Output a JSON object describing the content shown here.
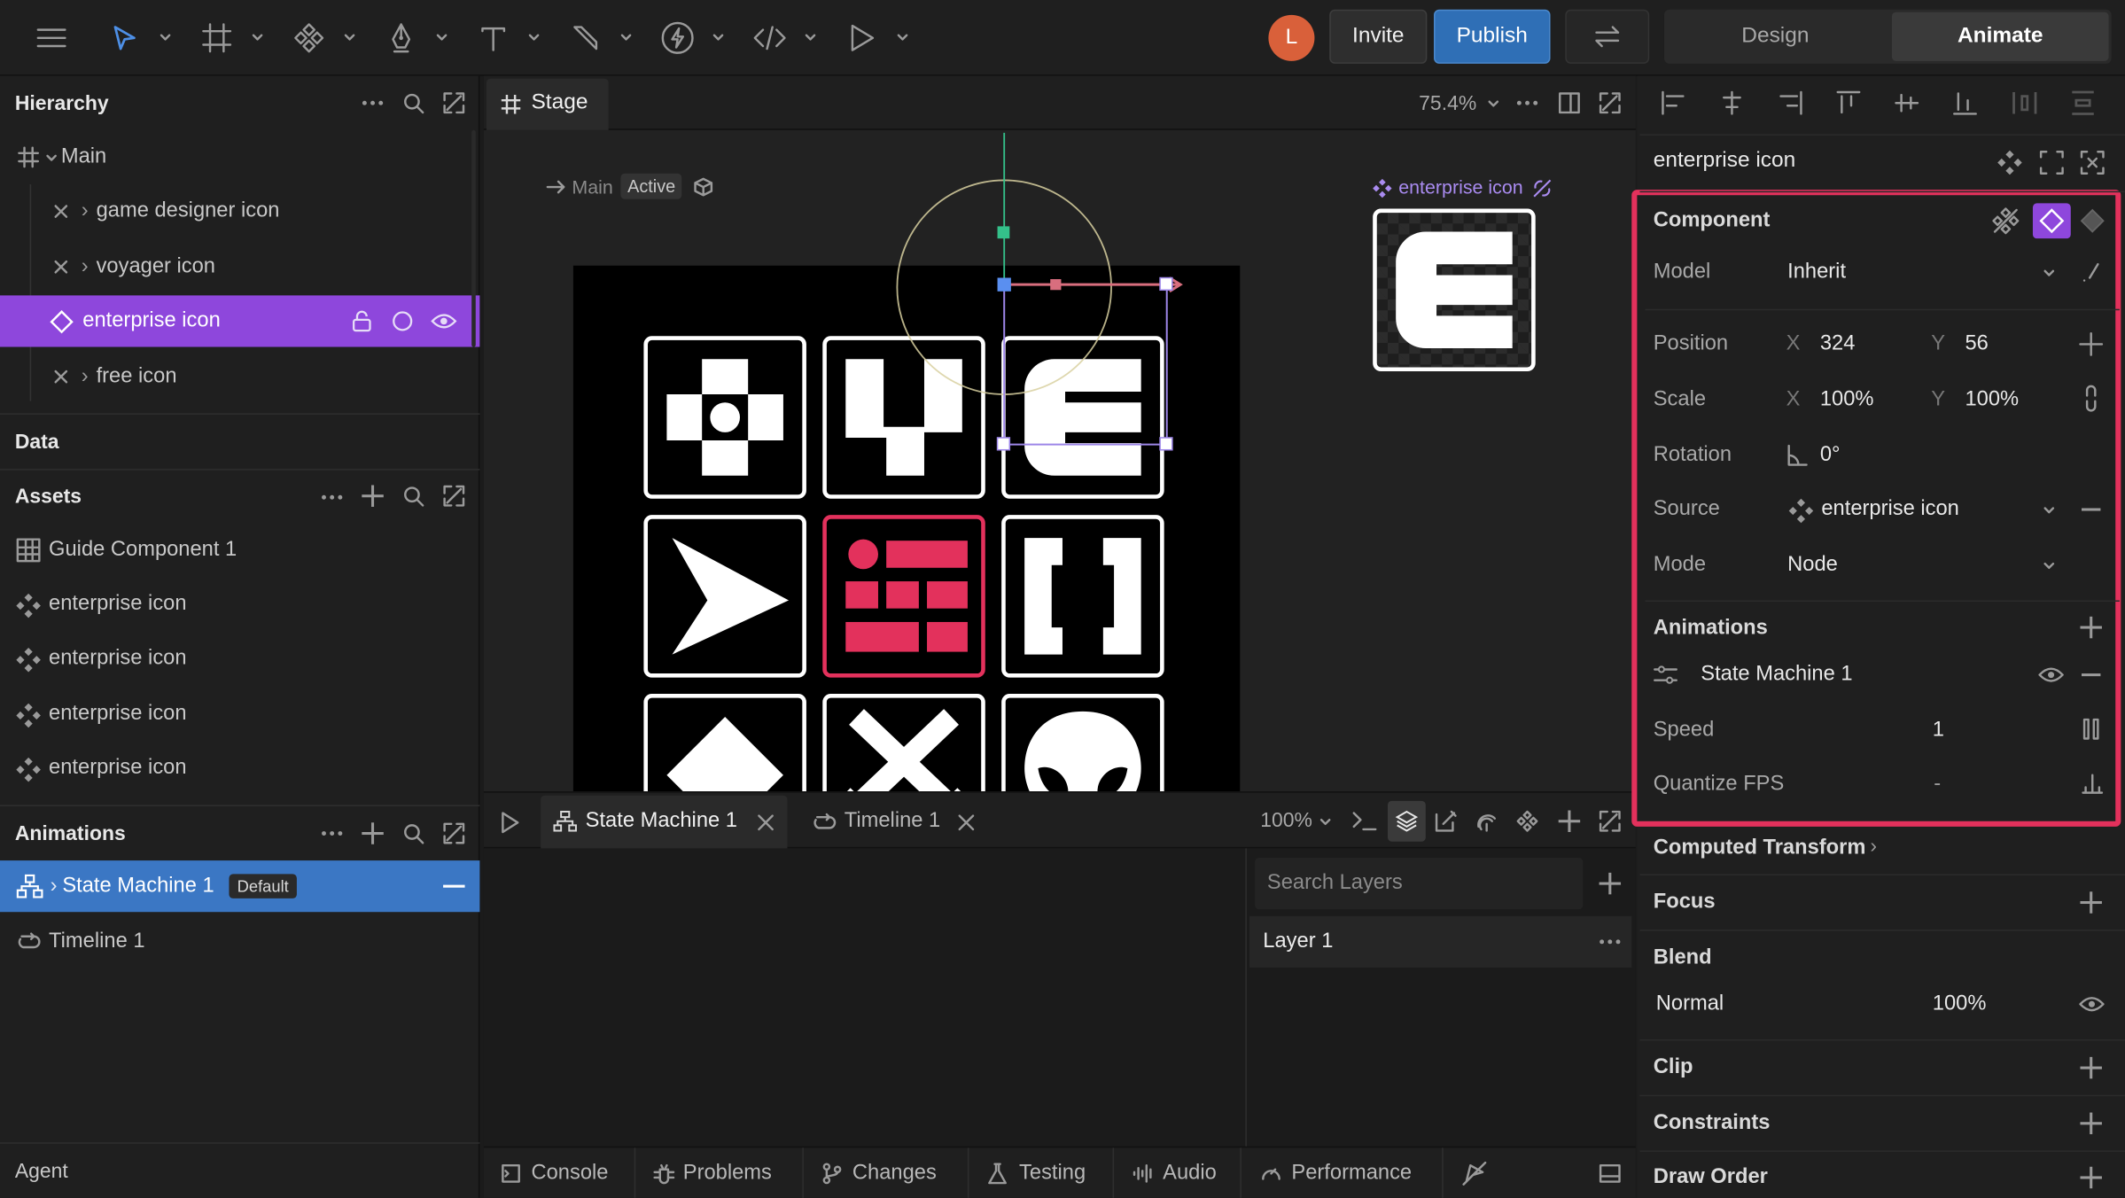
{
  "topbar": {
    "avatar_letter": "L",
    "invite_label": "Invite",
    "publish_label": "Publish",
    "mode_design": "Design",
    "mode_animate": "Animate"
  },
  "hierarchy": {
    "title": "Hierarchy",
    "items": [
      {
        "label": "Main"
      },
      {
        "label": "game designer icon"
      },
      {
        "label": "voyager icon"
      },
      {
        "label": "enterprise icon"
      },
      {
        "label": "free icon"
      }
    ]
  },
  "data_section": {
    "title": "Data"
  },
  "assets": {
    "title": "Assets",
    "items": [
      {
        "label": "Guide Component 1"
      },
      {
        "label": "enterprise icon"
      },
      {
        "label": "enterprise icon"
      },
      {
        "label": "enterprise icon"
      },
      {
        "label": "enterprise icon"
      }
    ]
  },
  "animations_panel": {
    "title": "Animations",
    "items": [
      {
        "label": "State Machine 1",
        "badge": "Default"
      },
      {
        "label": "Timeline 1"
      }
    ]
  },
  "agent": {
    "title": "Agent"
  },
  "stage": {
    "tab_label": "Stage",
    "zoom": "75.4%",
    "artboard_label": "Main",
    "artboard_state": "Active",
    "component_label": "enterprise icon"
  },
  "timeline_tabs": {
    "tabs": [
      {
        "label": "State Machine 1"
      },
      {
        "label": "Timeline 1"
      }
    ],
    "zoom": "100%",
    "search_placeholder": "Search Layers",
    "layer": "Layer 1"
  },
  "bottom_tabs": [
    "Console",
    "Problems",
    "Changes",
    "Testing",
    "Audio",
    "Performance"
  ],
  "inspector": {
    "title": "enterprise icon",
    "component_section": "Component",
    "model_label": "Model",
    "model_value": "Inherit",
    "position_label": "Position",
    "pos_x": "324",
    "pos_y": "56",
    "scale_label": "Scale",
    "scale_x": "100%",
    "scale_y": "100%",
    "rotation_label": "Rotation",
    "rotation_value": "0°",
    "source_label": "Source",
    "source_value": "enterprise icon",
    "mode_label": "Mode",
    "mode_value": "Node",
    "axis_x": "X",
    "axis_y": "Y",
    "animations_section": "Animations",
    "state_machine": "State Machine 1",
    "speed_label": "Speed",
    "speed_value": "1",
    "quantize_label": "Quantize FPS",
    "quantize_value": "-",
    "computed_transform": "Computed Transform",
    "focus": "Focus",
    "blend": "Blend",
    "blend_mode": "Normal",
    "blend_opacity": "100%",
    "clip": "Clip",
    "constraints": "Constraints",
    "draw_order": "Draw Order"
  },
  "colors": {
    "accent_purple": "#8e47dc",
    "accent_blue": "#3b77c4",
    "publish_blue": "#2f6fb6",
    "highlight_pink": "#e3315c"
  }
}
